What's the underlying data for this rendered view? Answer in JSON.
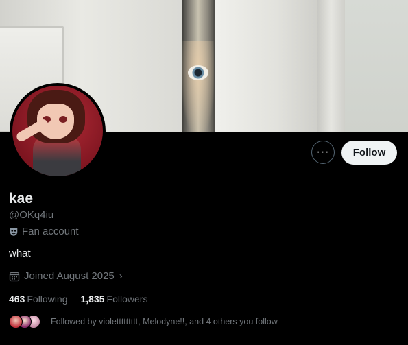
{
  "header": {
    "banner_alt": "profile-banner"
  },
  "actions": {
    "more_label": "···",
    "follow_label": "Follow"
  },
  "profile": {
    "name": "kae",
    "handle": "@OKq4iu",
    "label": "Fan account",
    "bio": "what",
    "joined": "Joined August 2025",
    "joined_chevron": "›"
  },
  "stats": {
    "following_count": "463",
    "following_label": "Following",
    "followers_count": "1,835",
    "followers_label": "Followers"
  },
  "followed_by": {
    "text": "Followed by violettttttttt, Melodyne!!, and 4 others you follow"
  },
  "colors": {
    "background": "#000000",
    "text_primary": "#e7e9ea",
    "text_secondary": "#71767b",
    "follow_button_bg": "#eff3f4"
  }
}
